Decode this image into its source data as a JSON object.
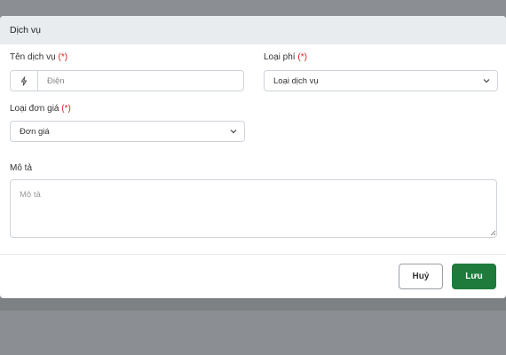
{
  "modal": {
    "title": "Dịch vụ"
  },
  "form": {
    "required_mark": "(*)",
    "service_name": {
      "label": "Tên dịch vụ",
      "placeholder": "Điện",
      "icon": "bolt-icon"
    },
    "fee_type": {
      "label": "Loại phí",
      "selected": "Loại dịch vụ"
    },
    "unit_price_type": {
      "label": "Loại đơn giá",
      "selected": "Đơn giá"
    },
    "description": {
      "label": "Mô tả",
      "placeholder": "Mô tả"
    }
  },
  "footer": {
    "cancel_label": "Huỷ",
    "save_label": "Lưu"
  },
  "colors": {
    "save_button": "#1e7b3c",
    "required": "#e02020",
    "header_bg": "#e9ecef"
  }
}
